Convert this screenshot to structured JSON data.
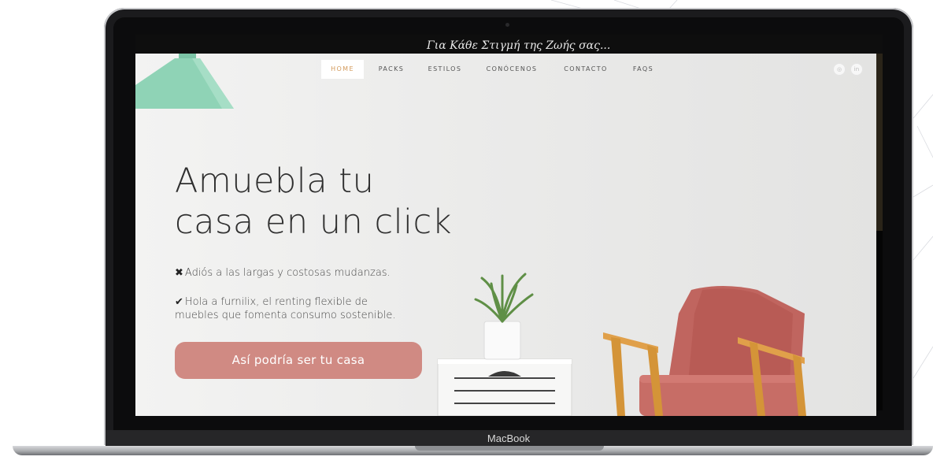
{
  "device": {
    "brand_label": "MacBook"
  },
  "background_site": {
    "tagline": "Για Κάθε Στιγμή της Ζωής σας..."
  },
  "site": {
    "nav": [
      {
        "label": "HOME",
        "active": true
      },
      {
        "label": "PACKS",
        "active": false
      },
      {
        "label": "ESTILOS",
        "active": false
      },
      {
        "label": "CONÓCENOS",
        "active": false
      },
      {
        "label": "CONTACTO",
        "active": false
      },
      {
        "label": "FAQS",
        "active": false
      }
    ],
    "social": [
      {
        "icon": "instagram-icon",
        "glyph": "◎"
      },
      {
        "icon": "linkedin-icon",
        "glyph": "in"
      }
    ],
    "hero": {
      "title_line1": "Amuebla tu",
      "title_line2": "casa en un click",
      "bullet1_symbol": "✖",
      "bullet1_text": "Adiós a las largas y costosas mudanzas.",
      "bullet2_symbol": "✔",
      "bullet2_text_line1": "Hola a furnilix, el renting flexible de",
      "bullet2_text_line2": "muebles que fomenta consumo sostenible.",
      "cta_label": "Así podría ser tu casa"
    },
    "colors": {
      "accent": "#d08a83",
      "nav_active": "#d39a5b",
      "lamp": "#8fd3b6",
      "chair_fabric": "#c0655f",
      "chair_wood": "#e0a04a"
    }
  }
}
